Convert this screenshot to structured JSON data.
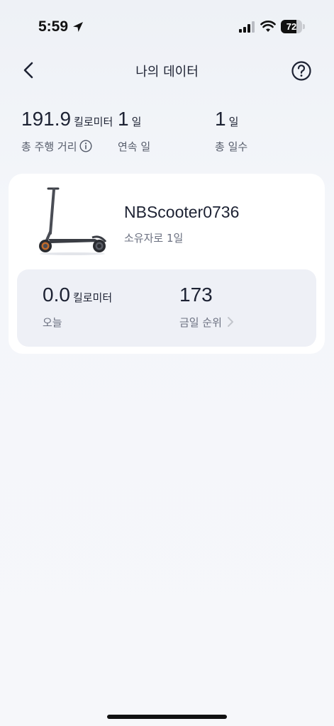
{
  "status_bar": {
    "time": "5:59",
    "battery_level": "72",
    "battery_fraction": 0.72,
    "icons": [
      "location-arrow-icon",
      "signal-icon",
      "wifi-icon",
      "battery-icon"
    ]
  },
  "header": {
    "title": "나의 데이터",
    "back_icon": "chevron-left-icon",
    "help_icon": "question-circle-icon"
  },
  "stats": {
    "total_distance": {
      "value": "191.9",
      "unit": "킬로미터",
      "label": "총 주행 거리"
    },
    "streak_days": {
      "value": "1",
      "unit": "일",
      "label": "연속 일"
    },
    "total_days": {
      "value": "1",
      "unit": "일",
      "label": "총 일수"
    }
  },
  "device": {
    "name": "NBScooter0736",
    "ownership": "소유자로 1일",
    "today_distance": {
      "value": "0.0",
      "unit": "킬로미터",
      "label": "오늘"
    },
    "today_rank": {
      "value": "173",
      "label": "금일 순위"
    }
  },
  "colors": {
    "background": "#f3f5f9",
    "card": "#ffffff",
    "panel": "#eef0f6",
    "text_primary": "#1d2233",
    "text_secondary": "#6b7080"
  }
}
